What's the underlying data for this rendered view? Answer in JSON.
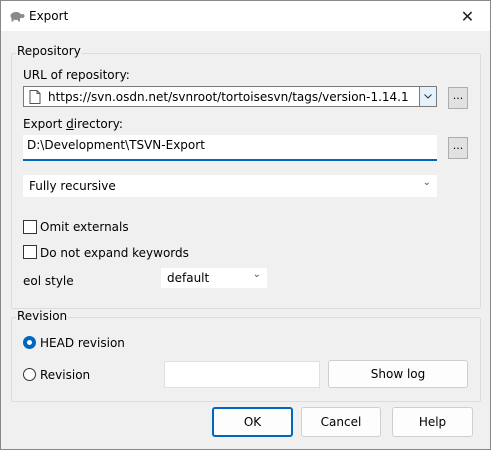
{
  "window": {
    "title": "Export",
    "close_glyph": "✕"
  },
  "repository": {
    "group_title": "Repository",
    "url_label": "URL of repository:",
    "url_value": "https://svn.osdn.net/svnroot/tortoisesvn/tags/version-1.14.1",
    "url_browse": "...",
    "dir_label": "Export directory:",
    "dir_value": "D:\\Development\\TSVN-Export",
    "dir_browse": "...",
    "depth_value": "Fully recursive",
    "omit_externals": {
      "label": "Omit externals",
      "checked": false
    },
    "no_expand_keywords": {
      "label": "Do not expand keywords",
      "checked": false
    },
    "eol_label": "eol style",
    "eol_value": "default"
  },
  "revision": {
    "group_title": "Revision",
    "head_label": "HEAD revision",
    "head_selected": true,
    "rev_label": "Revision",
    "rev_value": "",
    "show_log": "Show log"
  },
  "buttons": {
    "ok": "OK",
    "cancel": "Cancel",
    "help": "Help"
  },
  "colors": {
    "accent": "#0067c0"
  }
}
